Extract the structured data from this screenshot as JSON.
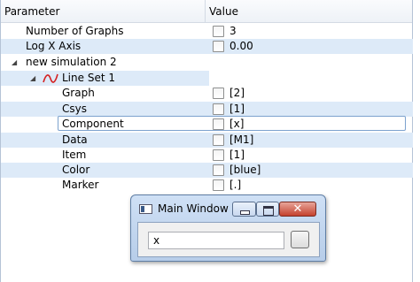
{
  "columns": {
    "parameter": "Parameter",
    "value": "Value"
  },
  "rows": [
    {
      "label": "Number of Graphs",
      "value": "3"
    },
    {
      "label": "Log X Axis",
      "value": "0.00"
    },
    {
      "label": "new simulation 2",
      "expander": "◢"
    },
    {
      "label": "Line Set 1",
      "expander": "◢"
    },
    {
      "label": "Graph",
      "value": "[2]"
    },
    {
      "label": "Csys",
      "value": "[1]"
    },
    {
      "label": "Component",
      "value": "[x]"
    },
    {
      "label": "Data",
      "value": "[M1]"
    },
    {
      "label": "Item",
      "value": "[1]"
    },
    {
      "label": "Color",
      "value": "[blue]"
    },
    {
      "label": "Marker",
      "value": "[.]"
    }
  ],
  "dialog": {
    "title": "Main Window",
    "input_value": "x",
    "close_glyph": "✕"
  },
  "colors": {
    "accent": "#ddeaf8",
    "curve": "#d42020"
  }
}
